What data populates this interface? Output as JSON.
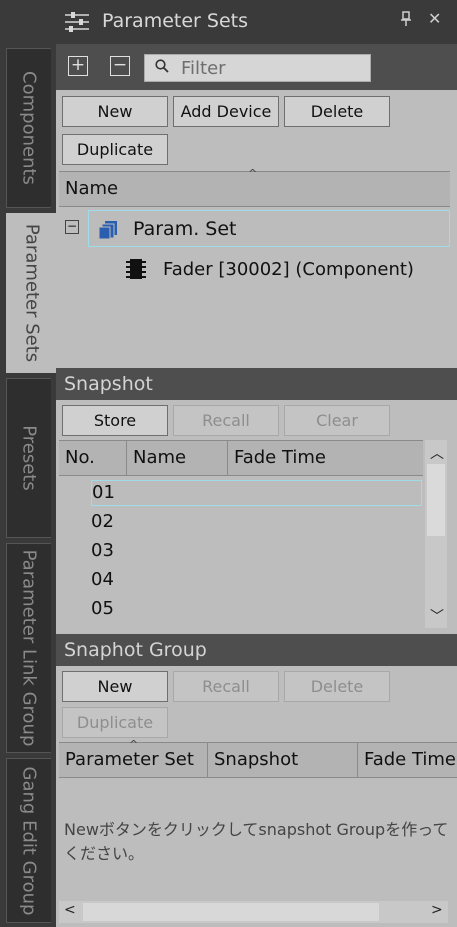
{
  "side_tabs": [
    {
      "label": "Components",
      "active": false
    },
    {
      "label": "Parameter Sets",
      "active": true
    },
    {
      "label": "Presets",
      "active": false
    },
    {
      "label": "Parameter Link Group",
      "active": false
    },
    {
      "label": "Gang Edit Group",
      "active": false
    }
  ],
  "panel": {
    "title": "Parameter Sets",
    "pin_icon": "pin-icon",
    "close_icon": "close-icon"
  },
  "toolbar": {
    "expand_label": "+",
    "collapse_label": "−",
    "filter_placeholder": "Filter"
  },
  "param_buttons": {
    "new": "New",
    "add_device": "Add Device",
    "delete": "Delete",
    "duplicate": "Duplicate"
  },
  "tree": {
    "column_name": "Name",
    "root": {
      "toggle": "−",
      "label": "Param. Set"
    },
    "child": {
      "label": "Fader [30002] (Component)"
    }
  },
  "snapshot": {
    "section_title": "Snapshot",
    "buttons": {
      "store": "Store",
      "recall": "Recall",
      "clear": "Clear"
    },
    "columns": {
      "no": "No.",
      "name": "Name",
      "fade_time": "Fade Time"
    },
    "rows": [
      {
        "no": "01",
        "name": "",
        "fade_time": ""
      },
      {
        "no": "02",
        "name": "",
        "fade_time": ""
      },
      {
        "no": "03",
        "name": "",
        "fade_time": ""
      },
      {
        "no": "04",
        "name": "",
        "fade_time": ""
      },
      {
        "no": "05",
        "name": "",
        "fade_time": ""
      }
    ]
  },
  "snapshot_group": {
    "section_title": "Snaphot Group",
    "buttons": {
      "new": "New",
      "recall": "Recall",
      "delete": "Delete",
      "duplicate": "Duplicate"
    },
    "columns": {
      "parameter_set": "Parameter Set",
      "snapshot": "Snapshot",
      "fade_time": "Fade Time"
    },
    "empty_message": "Newボタンをクリックしてsnapshot Groupを作ってください。"
  },
  "colors": {
    "panel_bg": "#bdbdbd",
    "dark_bg": "#3a3a3a",
    "section_bg": "#4e4e4e",
    "selection_border": "#9fdcea",
    "icon_blue": "#2a5fb0"
  }
}
